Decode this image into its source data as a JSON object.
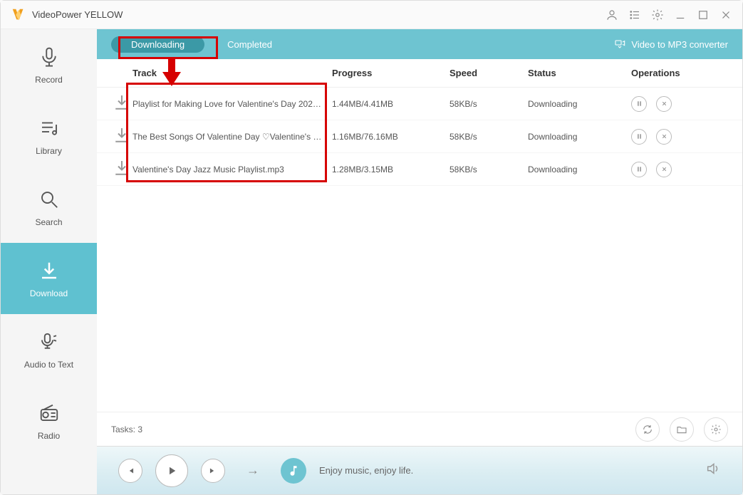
{
  "app": {
    "title": "VideoPower YELLOW"
  },
  "sidebar": {
    "items": [
      {
        "label": "Record"
      },
      {
        "label": "Library"
      },
      {
        "label": "Search"
      },
      {
        "label": "Download"
      },
      {
        "label": "Audio to Text"
      },
      {
        "label": "Radio"
      }
    ]
  },
  "tabs": {
    "downloading": "Downloading",
    "completed": "Completed",
    "converter": "Video to MP3 converter"
  },
  "columns": {
    "track": "Track",
    "progress": "Progress",
    "speed": "Speed",
    "status": "Status",
    "operations": "Operations"
  },
  "rows": [
    {
      "track": "Playlist for Making Love for Valentine's Day 2022....",
      "progress": "1.44MB/4.41MB",
      "speed": "58KB/s",
      "status": "Downloading"
    },
    {
      "track": "The Best Songs Of Valentine Day ♡Valentine's Da...",
      "progress": "1.16MB/76.16MB",
      "speed": "58KB/s",
      "status": "Downloading"
    },
    {
      "track": "Valentine's Day Jazz Music Playlist.mp3",
      "progress": "1.28MB/3.15MB",
      "speed": "58KB/s",
      "status": "Downloading"
    }
  ],
  "footer": {
    "tasks": "Tasks: 3"
  },
  "player": {
    "tagline": "Enjoy music, enjoy life."
  }
}
